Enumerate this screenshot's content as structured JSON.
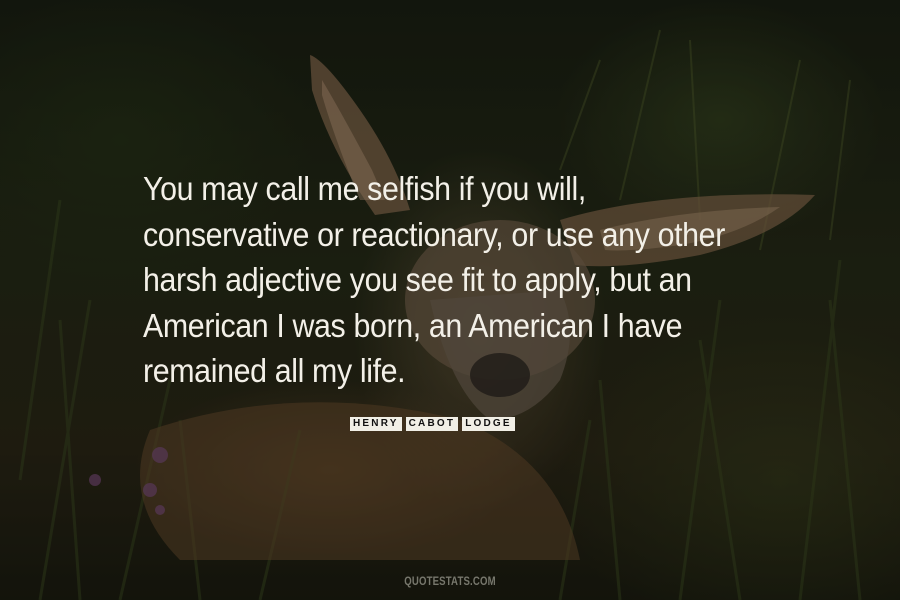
{
  "quote": {
    "lines": [
      "You may call me selfish if you will,",
      "conservative or reactionary, or use any other",
      "harsh adjective you see fit to apply, but an",
      "American I was born, an American I have",
      "remained all my life."
    ]
  },
  "author": {
    "words": [
      "HENRY",
      "CABOT",
      "LODGE"
    ]
  },
  "watermark": "QUOTESTATS.COM"
}
